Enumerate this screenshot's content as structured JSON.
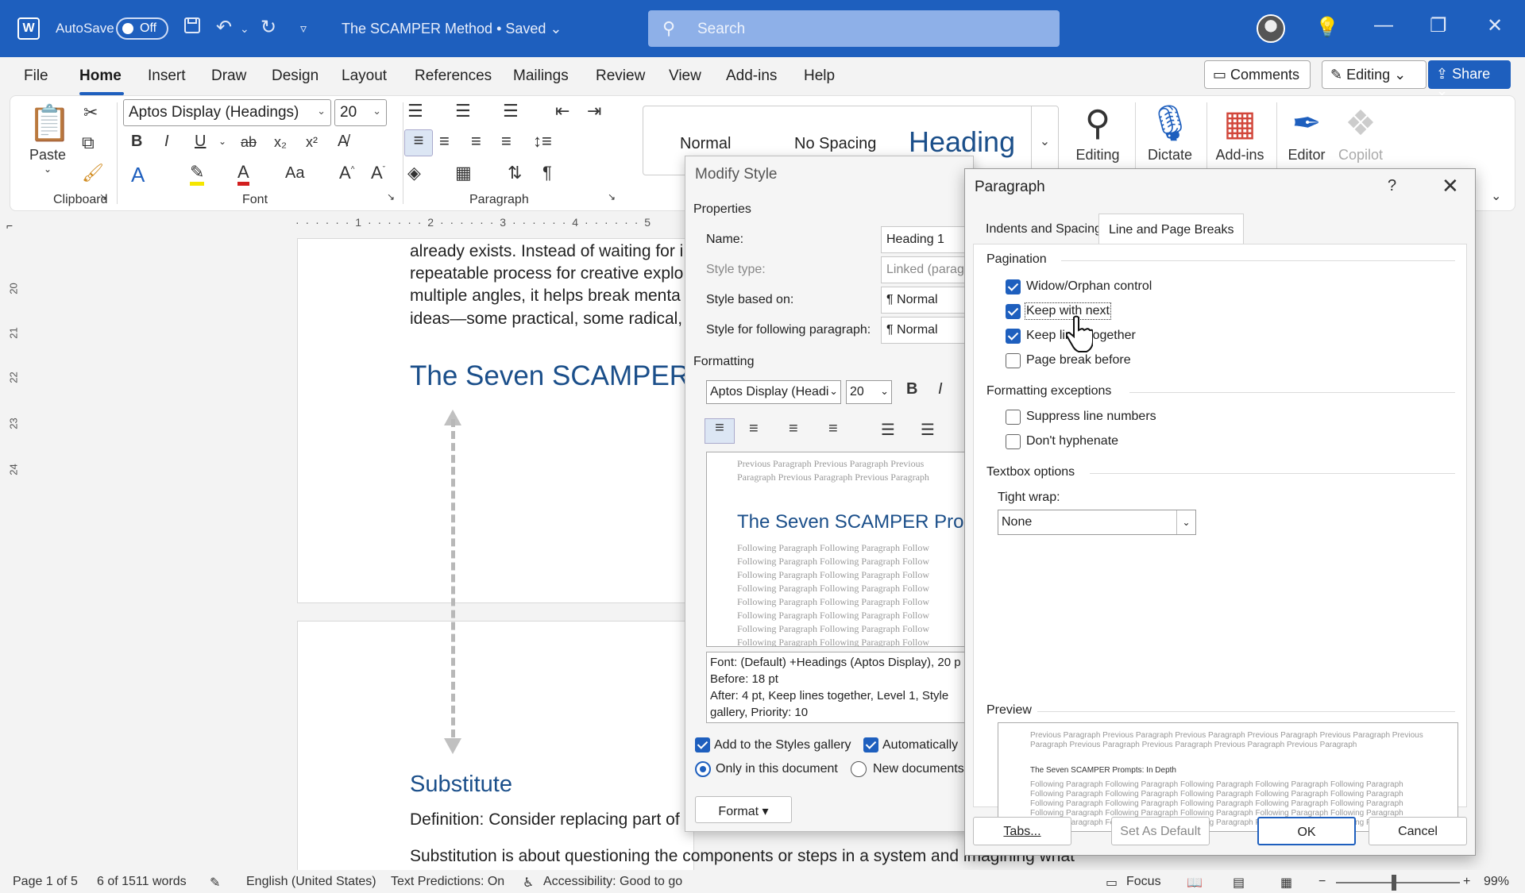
{
  "titlebar": {
    "autosave_label": "AutoSave",
    "autosave_state": "Off",
    "doc_title": "The SCAMPER Method • Saved",
    "search_placeholder": "Search",
    "word_icon": "W",
    "icons": [
      "word-icon",
      "save-icon",
      "undo-icon",
      "redo-icon",
      "customize-icon",
      "search-icon",
      "avatar",
      "lightbulb-icon",
      "minimize-icon",
      "restore-icon",
      "close-icon"
    ]
  },
  "menu": {
    "tabs": [
      "File",
      "Home",
      "Insert",
      "Draw",
      "Design",
      "Layout",
      "References",
      "Mailings",
      "Review",
      "View",
      "Add-ins",
      "Help"
    ],
    "comments_label": "Comments",
    "editing_label": "Editing",
    "share_label": "Share"
  },
  "ribbon": {
    "paste_label": "Paste",
    "clipboard_label": "Clipboard",
    "font_name": "Aptos Display (Headings)",
    "font_size": "20",
    "font_group_label": "Font",
    "bold": "B",
    "italic": "I",
    "underline": "U",
    "strike": "ab",
    "subscript": "x₂",
    "superscript": "x²",
    "aa": "Aa",
    "paragraph_group_label": "Paragraph",
    "styles": [
      "Normal",
      "No Spacing",
      "Heading"
    ],
    "editing_btn": "Editing",
    "dictate_btn": "Dictate",
    "addins_btn": "Add-ins",
    "editor_btn": "Editor",
    "copilot_btn": "Copilot"
  },
  "ruler": {
    "h": "· · · · · · 1 · · · · · · 2 · · · · · · 3 · · · · · · 4 · · · · · · 5",
    "v": [
      "20",
      "21",
      "22",
      "23",
      "24"
    ]
  },
  "document": {
    "lines": [
      "already exists. Instead of waiting for i",
      "repeatable process for creative explo",
      "multiple angles, it helps break menta",
      "ideas—some practical, some radical,"
    ],
    "heading": "The Seven SCAMPER",
    "subheading": "Substitute",
    "definition": "Definition: Consider replacing part of",
    "body_last": "Substitution is about questioning the components or steps in a system and imagining what"
  },
  "modify_style": {
    "title": "Modify Style",
    "properties": "Properties",
    "name_label": "Name:",
    "name_value": "Heading 1",
    "style_type_label": "Style type:",
    "style_type_value": "Linked (paragr",
    "based_on_label": "Style based on:",
    "based_on_value": "¶ Normal",
    "following_label": "Style for following paragraph:",
    "following_value": "¶ Normal",
    "formatting": "Formatting",
    "font": "Aptos Display (Headi",
    "size": "20",
    "bold": "B",
    "italic": "I",
    "preview_prev": [
      "Previous Paragraph Previous Paragraph Previous",
      "Paragraph Previous Paragraph Previous Paragraph"
    ],
    "preview_heading": "The Seven SCAMPER Prom",
    "preview_follow": "Following Paragraph Following Paragraph Follow",
    "description": [
      "Font: (Default) +Headings (Aptos Display), 20 p",
      "   Before:  18 pt",
      "   After:  4 pt, Keep lines together, Level 1, Style",
      "gallery, Priority: 10"
    ],
    "add_gallery": "Add to the Styles gallery",
    "auto_update": "Automatically",
    "only_doc": "Only in this document",
    "new_docs": "New documents",
    "format_btn": "Format ▾"
  },
  "paragraph": {
    "title": "Paragraph",
    "help": "?",
    "close": "✕",
    "tab1": "Indents and Spacing",
    "tab2": "Line and Page Breaks",
    "pagination": "Pagination",
    "widow": "Widow/Orphan control",
    "keep_next": "Keep with next",
    "keep_lines": "Keep lines together",
    "page_break": "Page break before",
    "exceptions": "Formatting exceptions",
    "suppress": "Suppress line numbers",
    "dont_hyph": "Don't hyphenate",
    "textbox": "Textbox options",
    "tight_wrap": "Tight wrap:",
    "tight_value": "None",
    "preview": "Preview",
    "preview_prev": [
      "Previous Paragraph Previous Paragraph Previous Paragraph Previous Paragraph Previous Paragraph Previous",
      "Paragraph Previous Paragraph Previous Paragraph Previous Paragraph Previous Paragraph"
    ],
    "preview_heading": "The Seven SCAMPER Prompts: In Depth",
    "preview_follow": "Following Paragraph Following Paragraph Following Paragraph Following Paragraph Following Paragraph",
    "tabs_btn": "Tabs...",
    "default_btn": "Set As Default",
    "ok_btn": "OK",
    "cancel_btn": "Cancel"
  },
  "status": {
    "page": "Page 1 of 5",
    "words": "6 of 1511 words",
    "language": "English (United States)",
    "predictions": "Text Predictions: On",
    "accessibility": "Accessibility: Good to go",
    "focus": "Focus",
    "zoom": "99%",
    "zoom_minus": "−",
    "zoom_plus": "+"
  }
}
